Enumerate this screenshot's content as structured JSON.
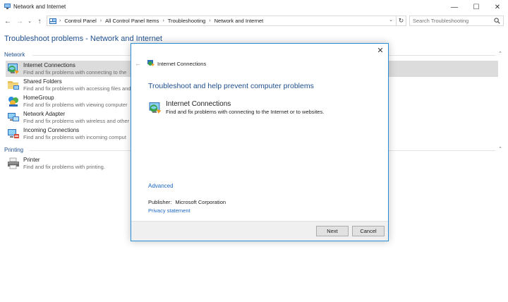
{
  "window": {
    "title": "Network and Internet",
    "minimize_glyph": "—",
    "maximize_glyph": "☐",
    "close_glyph": "✕"
  },
  "nav": {
    "back_glyph": "←",
    "forward_glyph": "→",
    "recent_glyph": "⌄",
    "up_glyph": "↑"
  },
  "address": {
    "location_icon": "control-panel-icon",
    "breadcrumbs": [
      "Control Panel",
      "All Control Panel Items",
      "Troubleshooting",
      "Network and Internet"
    ],
    "separator": "›",
    "dropdown_glyph": "⌄",
    "refresh_glyph": "↻"
  },
  "search": {
    "placeholder": "Search Troubleshooting",
    "icon": "search-icon"
  },
  "page": {
    "title": "Troubleshoot problems - Network and Internet",
    "collapse_glyph": "⌃"
  },
  "sections": [
    {
      "label": "Network",
      "items": [
        {
          "name": "Internet Connections",
          "desc": "Find and fix problems with connecting to the",
          "icon": "internet-connections-icon",
          "selected": true
        },
        {
          "name": "Shared Folders",
          "desc": "Find and fix problems with accessing files and",
          "icon": "shared-folders-icon"
        },
        {
          "name": "HomeGroup",
          "desc": "Find and fix problems with viewing computer",
          "icon": "homegroup-icon"
        },
        {
          "name": "Network Adapter",
          "desc": "Find and fix problems with wireless and other",
          "icon": "network-adapter-icon"
        },
        {
          "name": "Incoming Connections",
          "desc": "Find and fix problems with incoming comput",
          "icon": "incoming-connections-icon"
        }
      ]
    },
    {
      "label": "Printing",
      "items": [
        {
          "name": "Printer",
          "desc": "Find and fix problems with printing.",
          "icon": "printer-icon"
        }
      ]
    }
  ],
  "dialog": {
    "close_glyph": "✕",
    "back_glyph": "←",
    "title": "Internet Connections",
    "heading": "Troubleshoot and help prevent computer problems",
    "option_name": "Internet Connections",
    "option_desc": "Find and fix problems with connecting to the Internet or to websites.",
    "advanced_link": "Advanced",
    "publisher_label": "Publisher:",
    "publisher_value": "Microsoft Corporation",
    "privacy_link": "Privacy statement",
    "next_label": "Next",
    "cancel_label": "Cancel"
  },
  "colors": {
    "link_blue": "#1a66c2",
    "heading_blue": "#1e4e8c",
    "dialog_border": "#2b8fd8",
    "selection_gray": "#dcdcdc"
  }
}
